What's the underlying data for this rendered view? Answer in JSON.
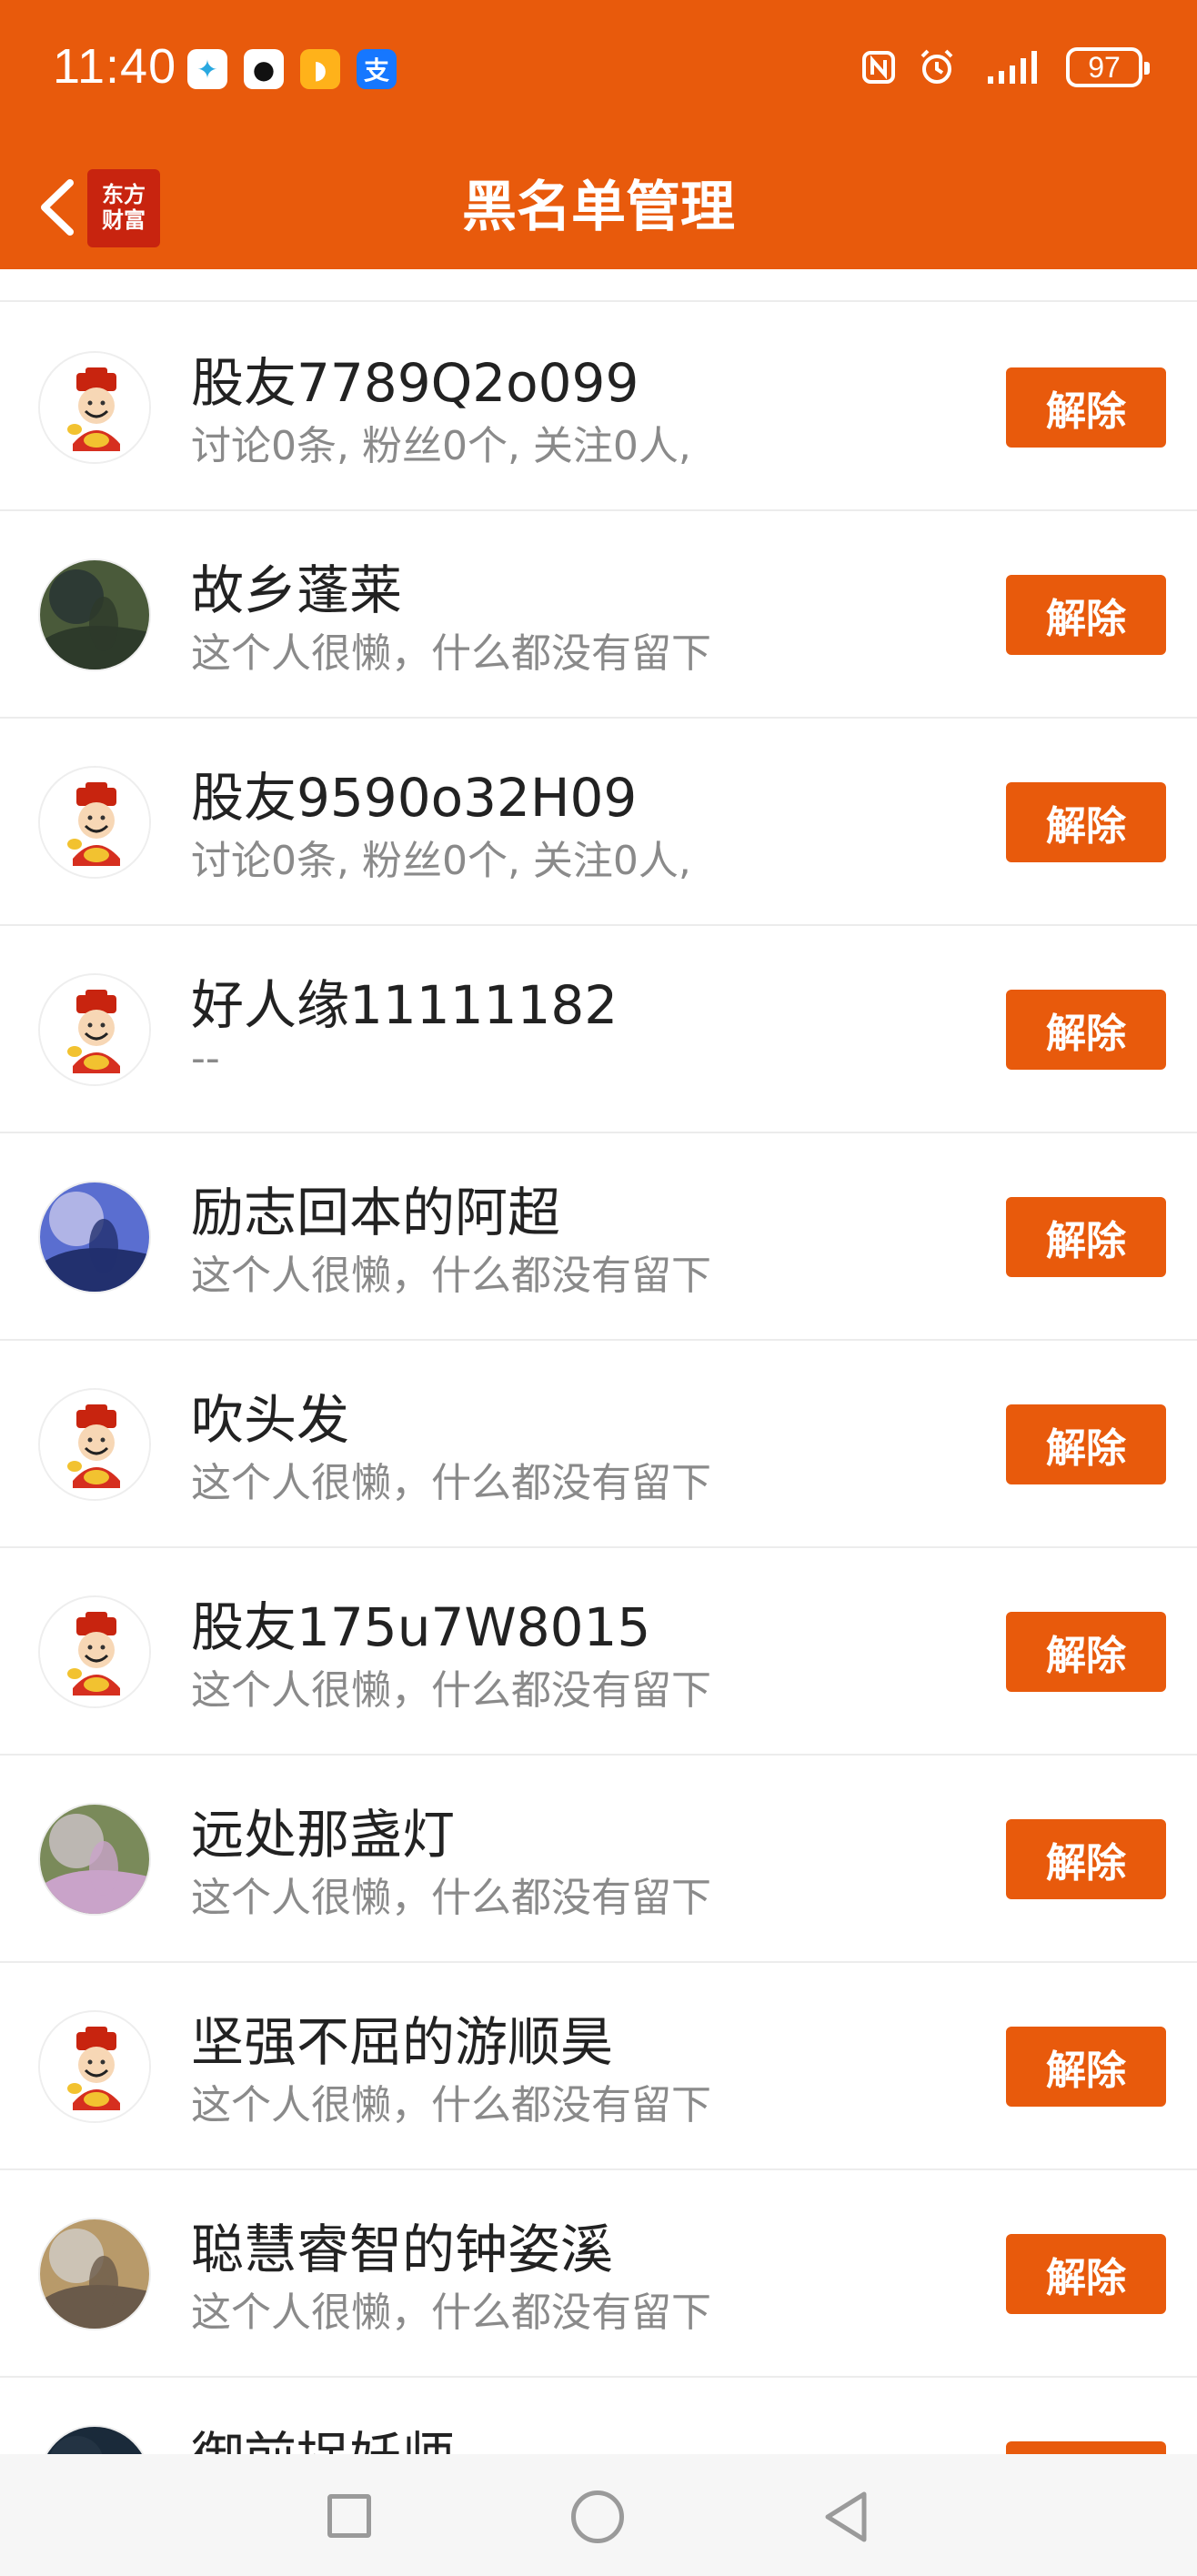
{
  "status_bar": {
    "time": "11:40",
    "app_icons": [
      {
        "icon": "colorful-app-icon",
        "bg": "#ffffff",
        "glyph": "✦",
        "color": "#29a8e0"
      },
      {
        "icon": "qq-icon",
        "bg": "#ffffff",
        "glyph": "●",
        "color": "#111111"
      },
      {
        "icon": "orange-app-icon",
        "bg": "#ffb21a",
        "glyph": "◗",
        "color": "#ffffff"
      },
      {
        "icon": "alipay-icon",
        "bg": "#1677ff",
        "glyph": "支",
        "color": "#ffffff"
      }
    ],
    "battery": "97"
  },
  "nav": {
    "logo_line1": "东方",
    "logo_line2": "财富",
    "title": "黑名单管理"
  },
  "accent_color": "#e85a0c",
  "users": [
    {
      "name": "股友7789Q2o099",
      "desc": "讨论0条, 粉丝0个, 关注0人,",
      "avatar": "mascot-avatar",
      "button": "解除"
    },
    {
      "name": "故乡蓬莱",
      "desc": "这个人很懒，什么都没有留下",
      "avatar": "photo-avatar-person",
      "button": "解除"
    },
    {
      "name": "股友9590o32H09",
      "desc": "讨论0条, 粉丝0个, 关注0人,",
      "avatar": "mascot-avatar",
      "button": "解除"
    },
    {
      "name": "好人缘11111182",
      "desc": "--",
      "avatar": "mascot-avatar",
      "button": "解除"
    },
    {
      "name": "励志回本的阿超",
      "desc": "这个人很懒，什么都没有留下",
      "avatar": "photo-avatar-anime",
      "button": "解除"
    },
    {
      "name": "吹头发",
      "desc": "这个人很懒，什么都没有留下",
      "avatar": "mascot-avatar",
      "button": "解除"
    },
    {
      "name": "股友175u7W8015",
      "desc": "这个人很懒，什么都没有留下",
      "avatar": "mascot-avatar",
      "button": "解除"
    },
    {
      "name": "远处那盏灯",
      "desc": "这个人很懒，什么都没有留下",
      "avatar": "photo-avatar-flowers",
      "button": "解除"
    },
    {
      "name": "坚强不屈的游顺昊",
      "desc": "这个人很懒，什么都没有留下",
      "avatar": "mascot-avatar",
      "button": "解除"
    },
    {
      "name": "聪慧睿智的钟姿溪",
      "desc": "这个人很懒，什么都没有留下",
      "avatar": "photo-avatar-castle",
      "button": "解除"
    },
    {
      "name": "御前捉妖师",
      "desc": "",
      "avatar": "photo-avatar-dark",
      "button": "解除"
    }
  ]
}
